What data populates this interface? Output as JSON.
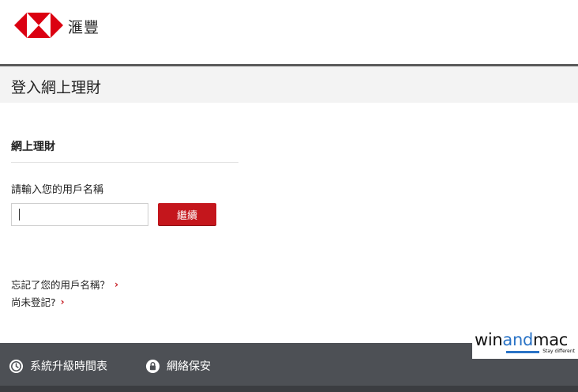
{
  "header": {
    "logo_icon": "hsbc-hexagon-logo",
    "brand_name": "滙豐",
    "brand_color": "#db0011"
  },
  "page": {
    "title": "登入網上理財"
  },
  "login": {
    "heading": "網上理財",
    "field_label": "請輸入您的用戶名稱",
    "username_value": "",
    "continue_label": "繼續",
    "button_color": "#c4161c"
  },
  "links": {
    "forgot_username": "忘記了您的用戶名稱？",
    "not_registered": "尚未登記?",
    "chevron_icon": "chevron-right-icon"
  },
  "footer": {
    "schedule_label": "系統升級時間表",
    "schedule_icon": "clock-icon",
    "security_label": "網絡保安",
    "security_icon": "lock-icon",
    "background": "#4d5055"
  },
  "watermark": {
    "part1": "win",
    "part2": "and",
    "part3": "mac",
    "tagline": "Stay different"
  }
}
